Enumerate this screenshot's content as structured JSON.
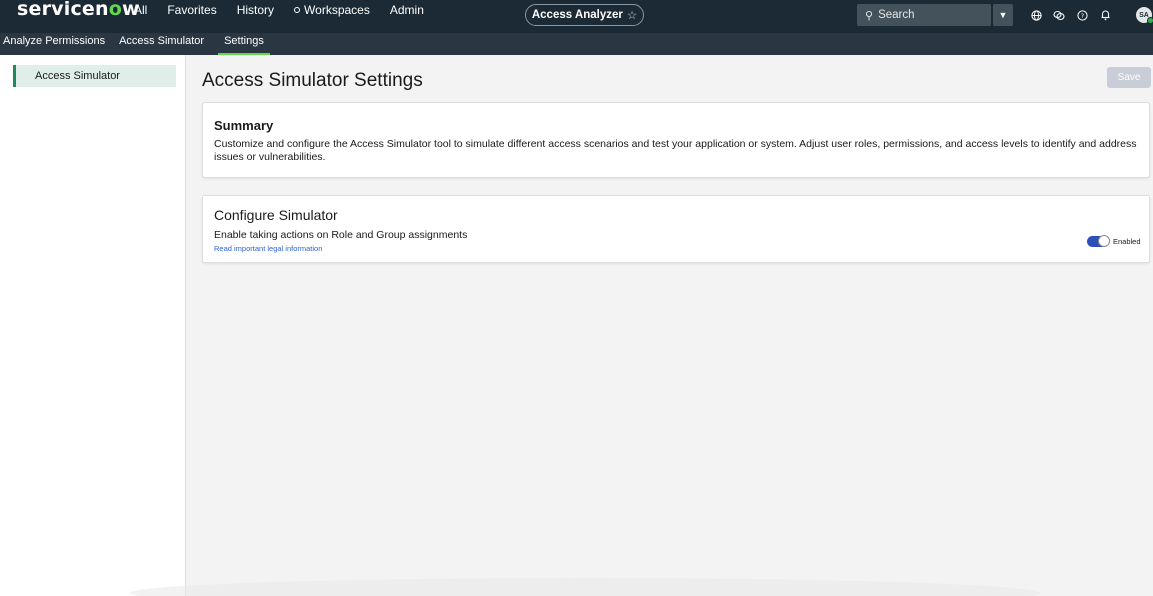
{
  "header": {
    "logo_text_prefix": "servicen",
    "logo_text_accent": "o",
    "logo_text_suffix": "w",
    "nav": [
      "All",
      "Favorites",
      "History",
      "Workspaces",
      "Admin"
    ],
    "app_pill": "Access Analyzer",
    "app_pill_star": "☆",
    "search_placeholder": "Search",
    "avatar_initials": "SA",
    "icons": [
      "globe-icon",
      "chat-icon",
      "help-icon",
      "bell-icon"
    ]
  },
  "subnav": {
    "tabs": [
      "Analyze Permissions",
      "Access Simulator",
      "Settings"
    ],
    "active": "Settings"
  },
  "leftnav": {
    "items": [
      "Access Simulator"
    ]
  },
  "main": {
    "title": "Access Simulator Settings",
    "save_label": "Save",
    "summary": {
      "heading": "Summary",
      "text": "Customize and configure the Access Simulator tool to simulate different access scenarios and test your application or system. Adjust user roles, permissions, and access levels to identify and address issues or vulnerabilities."
    },
    "config": {
      "heading": "Configure Simulator",
      "label": "Enable taking actions on Role and Group assignments",
      "link": "Read important legal information",
      "toggle_label": "Enabled",
      "toggle_on": true
    }
  },
  "colors": {
    "header_bg": "#1b2a35",
    "subnav_bg": "#2a3742",
    "brand_green": "#62d84e",
    "toggle_blue": "#2f4fb8",
    "link_blue": "#2f63d6"
  }
}
